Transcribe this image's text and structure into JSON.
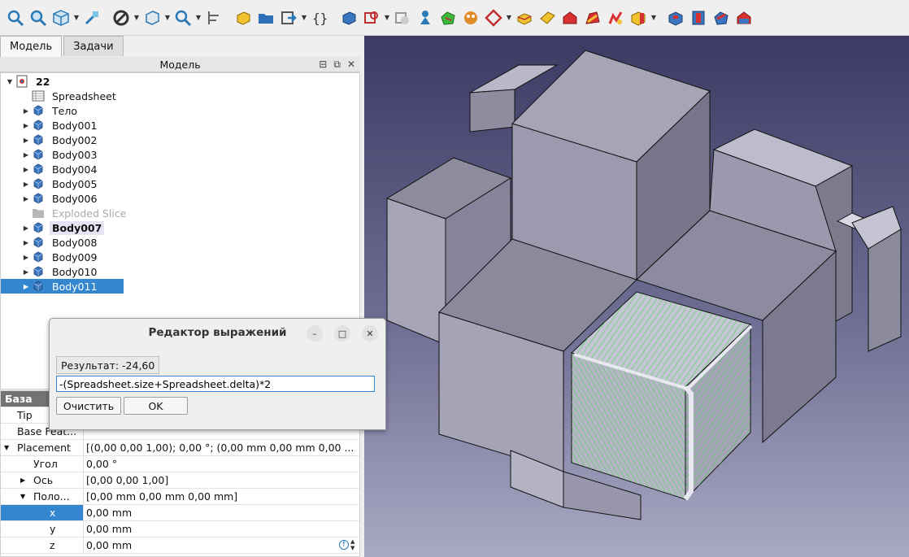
{
  "tabs": [
    "Модель",
    "Задачи"
  ],
  "model_panel": {
    "header": "Модель"
  },
  "tree": {
    "root": "22",
    "items": [
      {
        "label": "Spreadsheet",
        "icon": "spreadsheet-icon",
        "state": "normal",
        "expandable": false
      },
      {
        "label": "Тело",
        "icon": "body-icon",
        "state": "normal",
        "expandable": true
      },
      {
        "label": "Body001",
        "icon": "body-icon",
        "state": "normal",
        "expandable": true
      },
      {
        "label": "Body002",
        "icon": "body-icon",
        "state": "normal",
        "expandable": true
      },
      {
        "label": "Body003",
        "icon": "body-icon",
        "state": "normal",
        "expandable": true
      },
      {
        "label": "Body004",
        "icon": "body-icon",
        "state": "normal",
        "expandable": true
      },
      {
        "label": "Body005",
        "icon": "body-icon",
        "state": "normal",
        "expandable": true
      },
      {
        "label": "Body006",
        "icon": "body-icon",
        "state": "normal",
        "expandable": true
      },
      {
        "label": "Exploded Slice",
        "icon": "folder-icon",
        "state": "disabled",
        "expandable": false
      },
      {
        "label": "Body007",
        "icon": "body-icon",
        "state": "active",
        "expandable": true
      },
      {
        "label": "Body008",
        "icon": "body-icon",
        "state": "normal",
        "expandable": true
      },
      {
        "label": "Body009",
        "icon": "body-icon",
        "state": "normal",
        "expandable": true
      },
      {
        "label": "Body010",
        "icon": "body-icon",
        "state": "normal",
        "expandable": true
      },
      {
        "label": "Body011",
        "icon": "body-icon",
        "state": "selected",
        "expandable": true
      }
    ]
  },
  "properties": {
    "group": "База",
    "rows": [
      {
        "name": "Tip",
        "value": "",
        "indent": 0
      },
      {
        "name": "Base Feat...",
        "value": "",
        "indent": 0
      },
      {
        "name": "Placement",
        "value": "[(0,00 0,00 1,00); 0,00 °; (0,00 mm  0,00 mm  0,00 ...",
        "indent": 0,
        "expander": "open"
      },
      {
        "name": "Угол",
        "value": "0,00 °",
        "indent": 1
      },
      {
        "name": "Ось",
        "value": "[0,00 0,00 1,00]",
        "indent": 1,
        "expander": "closed"
      },
      {
        "name": "Поло...",
        "value": "[0,00 mm  0,00 mm  0,00 mm]",
        "indent": 1,
        "expander": "open"
      },
      {
        "name": "x",
        "value": "0,00 mm",
        "indent": 2,
        "selected": true
      },
      {
        "name": "y",
        "value": "0,00 mm",
        "indent": 2
      },
      {
        "name": "z",
        "value": "0,00 mm",
        "indent": 2
      }
    ]
  },
  "dialog": {
    "title": "Редактор выражений",
    "result": "Результат:  -24,60",
    "expression": "-(Spreadsheet.size+Spreadsheet.delta)*2",
    "clear_label": "Очистить",
    "ok_label": "OK"
  },
  "colors": {
    "selection": "#3586d0",
    "preselect_green": "#3bdc3b",
    "viewport_top": "#3c3a63",
    "viewport_bottom": "#a9a8c3"
  }
}
